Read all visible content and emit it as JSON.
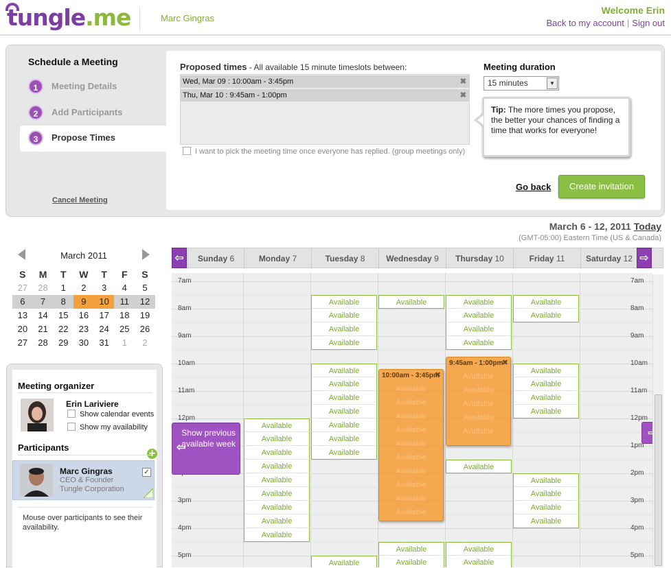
{
  "header": {
    "logo_main": "tungle",
    "logo_suffix": ".me",
    "user_name": "Marc Gingras",
    "welcome": "Welcome Erin",
    "back_link": "Back to my account",
    "sign_out": "Sign out",
    "link_separator": "|"
  },
  "steps": {
    "title": "Schedule a Meeting",
    "items": [
      {
        "num": "1",
        "label": "Meeting Details"
      },
      {
        "num": "2",
        "label": "Add Participants"
      },
      {
        "num": "3",
        "label": "Propose Times"
      }
    ],
    "cancel": "Cancel Meeting"
  },
  "proposed": {
    "title_bold": "Proposed times",
    "title_rest": " - All available 15 minute timeslots between:",
    "rows": [
      "Wed, Mar 09 : 10:00am - 3:45pm",
      "Thu, Mar 10 : 9:45am - 1:00pm"
    ],
    "pick_label": "I want to pick the meeting time once everyone has replied. (group meetings only)"
  },
  "duration": {
    "title": "Meeting duration",
    "value": "15 minutes"
  },
  "tip": {
    "label": "Tip:",
    "text": " The more times you propose, the better your chances of finding a time that works for everyone!"
  },
  "actions": {
    "go_back": "Go back",
    "create": "Create invitation"
  },
  "week": {
    "range": "March 6 - 12, 2011",
    "today": "Today",
    "timezone": "(GMT-05:00) Eastern Time (US & Canada)"
  },
  "minical": {
    "title": "March 2011",
    "headers": [
      "S",
      "M",
      "T",
      "W",
      "T",
      "F",
      "S"
    ],
    "weeks": [
      [
        "27",
        "28",
        "1",
        "2",
        "3",
        "4",
        "5"
      ],
      [
        "6",
        "7",
        "8",
        "9",
        "10",
        "11",
        "12"
      ],
      [
        "13",
        "14",
        "15",
        "16",
        "17",
        "18",
        "19"
      ],
      [
        "20",
        "21",
        "22",
        "23",
        "24",
        "25",
        "26"
      ],
      [
        "27",
        "28",
        "29",
        "30",
        "31",
        "1",
        "2"
      ]
    ]
  },
  "organizer": {
    "title": "Meeting organizer",
    "name": "Erin Lariviere",
    "show_cal": "Show calendar events",
    "show_avail": "Show my availability"
  },
  "participants": {
    "title": "Participants",
    "add": "+",
    "name": "Marc Gingras",
    "role": "CEO & Founder",
    "company": "Tungle Corporation",
    "checkmark": "✓",
    "hint": "Mouse over participants to see their availability."
  },
  "calendar": {
    "days": [
      {
        "name": "Sunday",
        "num": "6"
      },
      {
        "name": "Monday",
        "num": "7"
      },
      {
        "name": "Tuesday",
        "num": "8"
      },
      {
        "name": "Wednesday",
        "num": "9"
      },
      {
        "name": "Thursday",
        "num": "10"
      },
      {
        "name": "Friday",
        "num": "11"
      },
      {
        "name": "Saturday",
        "num": "12"
      }
    ],
    "hours": [
      "7am",
      "8am",
      "9am",
      "10am",
      "11am",
      "12pm",
      "1pm",
      "2pm",
      "3pm",
      "4pm",
      "5pm"
    ],
    "available_label": "Available",
    "events": [
      {
        "label": "10:00am - 3:45pm"
      },
      {
        "label": "9:45am - 1:00pm"
      }
    ],
    "prev_week": "Show previous available week",
    "nav_prev": "⇦",
    "nav_next": "⇨",
    "remove_symbol": "✖"
  },
  "colors": {
    "brand_purple": "#7b3fa3",
    "brand_green": "#8abe44",
    "event_orange": "#f5962a"
  }
}
